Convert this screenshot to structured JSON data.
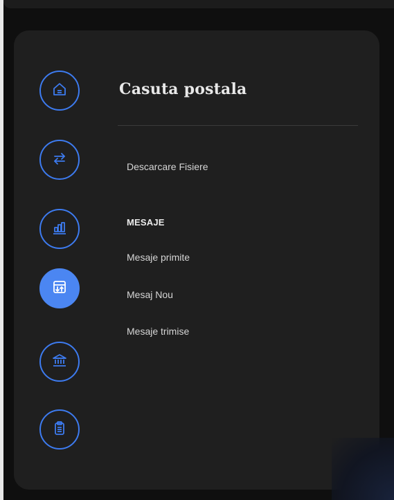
{
  "panel": {
    "title": "Casuta postala"
  },
  "rail": {
    "items": [
      {
        "icon": "home-icon",
        "active": false
      },
      {
        "icon": "transfer-icon",
        "active": false
      },
      {
        "icon": "chart-icon",
        "active": false
      },
      {
        "icon": "inbox-transfer-icon",
        "active": true
      },
      {
        "icon": "bank-icon",
        "active": false
      },
      {
        "icon": "clipboard-icon",
        "active": false
      }
    ]
  },
  "menu": {
    "download_files": "Descarcare Fisiere",
    "messages_heading": "MESAJE",
    "received_messages": "Mesaje primite",
    "new_message": "Mesaj Nou",
    "sent_messages": "Mesaje trimise"
  },
  "colors": {
    "accent": "#3d7bf0",
    "active_fill": "#4b86f2",
    "panel_bg": "#1f1f1f",
    "text": "#d6d6d6"
  }
}
